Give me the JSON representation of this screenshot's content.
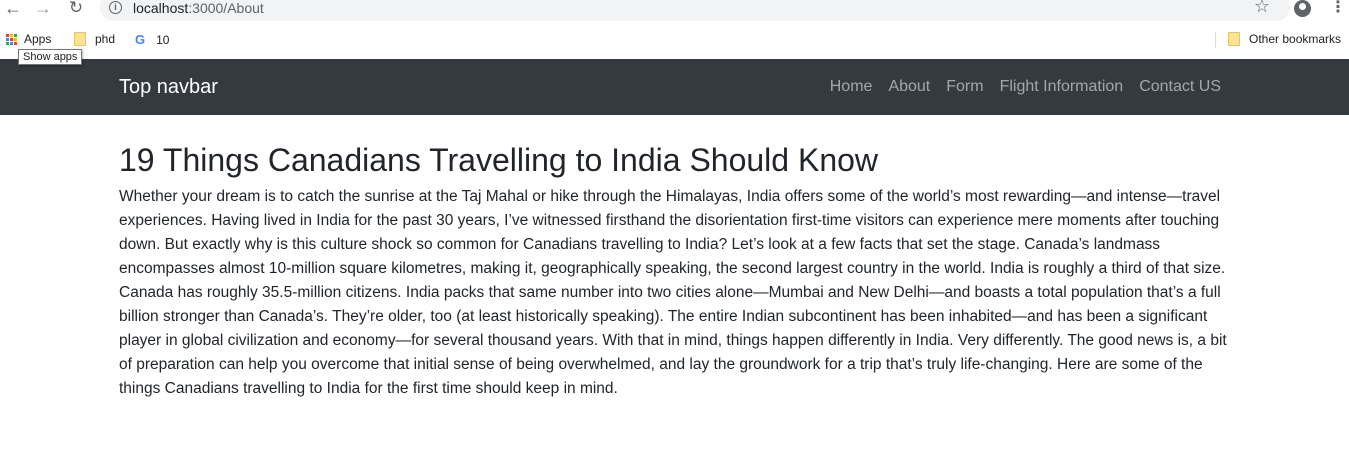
{
  "browser": {
    "url_host": "localhost",
    "url_path": ":3000/About",
    "bookmarks": {
      "apps_label": "Apps",
      "phd_label": "phd",
      "ten_label": "10",
      "other_label": "Other bookmarks"
    },
    "tooltip": "Show apps"
  },
  "navbar": {
    "brand": "Top navbar",
    "links": [
      "Home",
      "About",
      "Form",
      "Flight Information",
      "Contact US"
    ]
  },
  "main": {
    "title": "19 Things Canadians Travelling to India Should Know",
    "body": "Whether your dream is to catch the sunrise at the Taj Mahal or hike through the Himalayas, India offers some of the world’s most rewarding—and intense—travel experiences. Having lived in India for the past 30 years, I’ve witnessed firsthand the disorientation first-time visitors can experience mere moments after touching down. But exactly why is this culture shock so common for Canadians travelling to India? Let’s look at a few facts that set the stage. Canada’s landmass encompasses almost 10-million square kilometres, making it, geographically speaking, the second largest country in the world. India is roughly a third of that size. Canada has roughly 35.5-million citizens. India packs that same number into two cities alone—Mumbai and New Delhi—and boasts a total population that’s a full billion stronger than Canada’s. They’re older, too (at least historically speaking). The entire Indian subcontinent has been inhabited—and has been a significant player in global civilization and economy—for several thousand years. With that in mind, things happen differently in India. Very differently. The good news is, a bit of preparation can help you overcome that initial sense of being overwhelmed, and lay the groundwork for a trip that’s truly life-changing. Here are some of the things Canadians travelling to India for the first time should keep in mind."
  },
  "colors": {
    "navbar_bg": "#343a40",
    "nav_link": "rgba(255,255,255,0.55)",
    "text": "#212529"
  },
  "icons": [
    "back-arrow-icon",
    "forward-arrow-icon",
    "reload-icon",
    "info-icon",
    "star-icon",
    "profile-icon",
    "menu-dots-icon",
    "apps-grid-icon",
    "folder-icon",
    "google-icon"
  ]
}
